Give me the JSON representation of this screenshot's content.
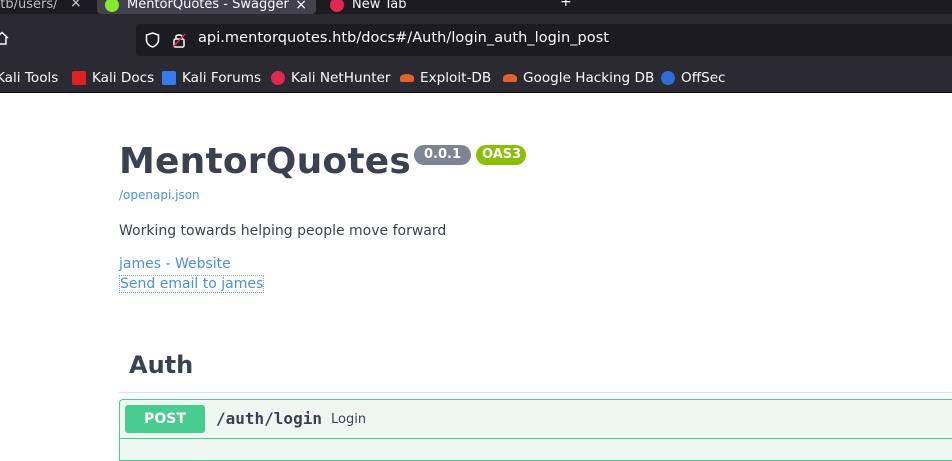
{
  "browser": {
    "tabs": [
      {
        "title": "htb/users/",
        "active": false
      },
      {
        "title": "MentorQuotes - Swagger",
        "active": true
      },
      {
        "title": "New Tab",
        "active": false
      }
    ],
    "close_glyph": "×",
    "new_tab_glyph": "+",
    "url": "api.mentorquotes.htb/docs#/Auth/login_auth_login_post",
    "bookmarks": [
      {
        "label": "Kali Tools",
        "icon": "kali-icon",
        "color": "#367bf0"
      },
      {
        "label": "Kali Docs",
        "icon": "kali-docs-icon",
        "color": "#e02020"
      },
      {
        "label": "Kali Forums",
        "icon": "kali-forums-icon",
        "color": "#367bf0"
      },
      {
        "label": "Kali NetHunter",
        "icon": "nethunter-icon",
        "color": "#e22850"
      },
      {
        "label": "Exploit-DB",
        "icon": "exploit-db-icon",
        "color": "#e0632b"
      },
      {
        "label": "Google Hacking DB",
        "icon": "ghdb-icon",
        "color": "#e0632b"
      },
      {
        "label": "OffSec",
        "icon": "offsec-icon",
        "color": "#2f6ed8"
      }
    ]
  },
  "info": {
    "title": "MentorQuotes",
    "version": "0.0.1",
    "oas": "OAS3",
    "spec_link": "/openapi.json",
    "description": "Working towards helping people move forward",
    "contact_website": "james - Website",
    "contact_email": "Send email to james"
  },
  "tags": [
    {
      "name": "Auth",
      "operations": [
        {
          "method": "POST",
          "path": "/auth/login",
          "summary": "Login"
        }
      ]
    }
  ],
  "colors": {
    "post": "#49cc90",
    "post_bg": "#edf8f3",
    "link": "#4990e2",
    "text": "#3b4151",
    "badge_version": "#7d8492",
    "badge_oas": "#89bf04"
  }
}
